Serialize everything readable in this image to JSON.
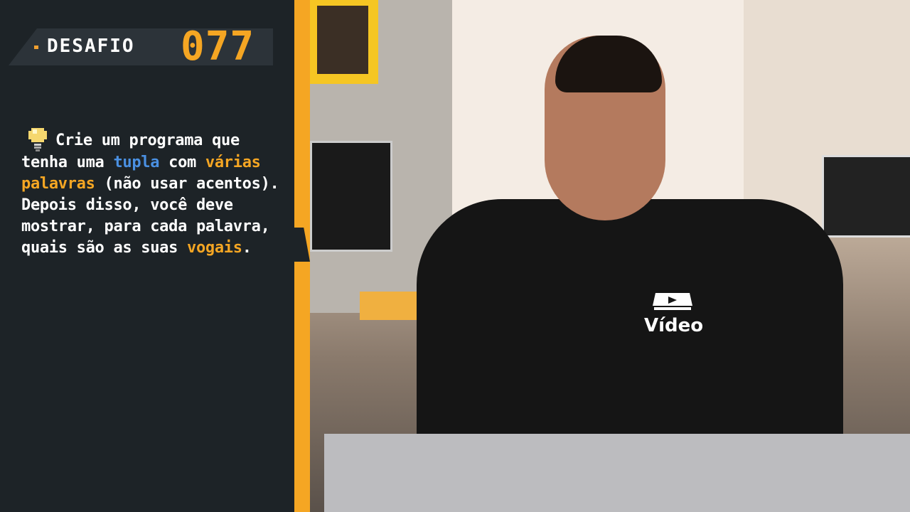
{
  "header": {
    "label": "DESAFIO",
    "number": "077"
  },
  "challenge": {
    "parts": [
      {
        "text": "Crie um programa que tenha uma ",
        "style": "normal"
      },
      {
        "text": "tupla",
        "style": "blue"
      },
      {
        "text": " com ",
        "style": "normal"
      },
      {
        "text": "várias palavras",
        "style": "orange"
      },
      {
        "text": " (não usar acentos). Depois disso, você deve mostrar, para cada palavra, quais são as suas ",
        "style": "normal"
      },
      {
        "text": "vogais",
        "style": "orange"
      },
      {
        "text": ".",
        "style": "normal"
      }
    ]
  },
  "shirt_logo": "Vídeo",
  "colors": {
    "panel": "#1d2327",
    "accent": "#f5a623",
    "highlight_blue": "#4a90e2"
  },
  "icons": {
    "bulb": "lightbulb-icon"
  }
}
